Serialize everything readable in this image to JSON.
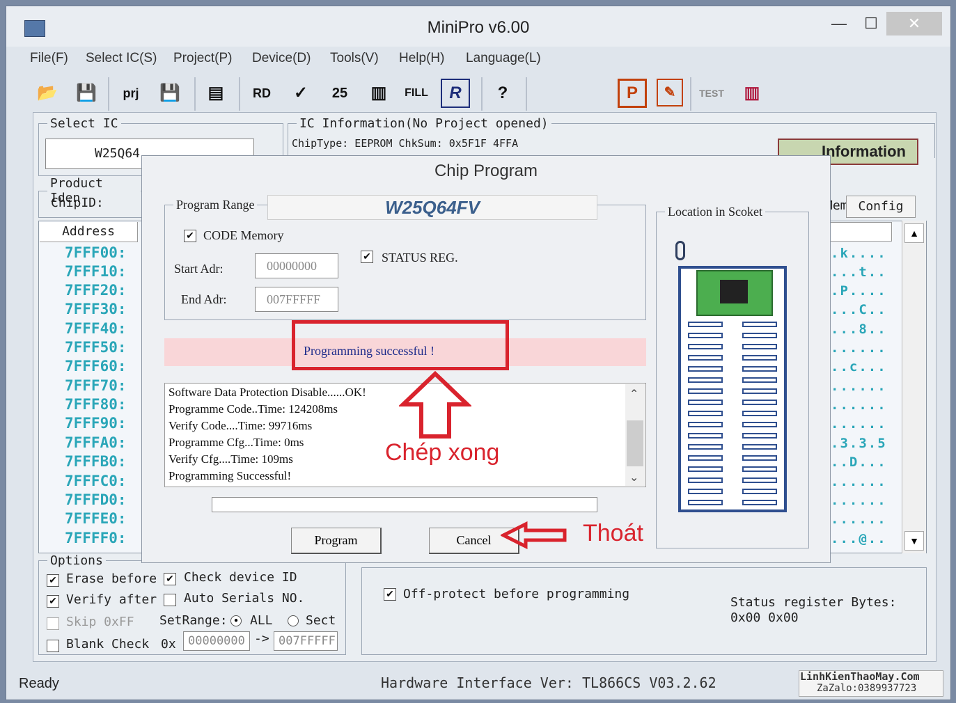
{
  "window": {
    "title": "MiniPro v6.00",
    "min": "—",
    "max": "☐",
    "close": "✕"
  },
  "menu": [
    "File(F)",
    "Select IC(S)",
    "Project(P)",
    "Device(D)",
    "Tools(V)",
    "Help(H)",
    "Language(L)"
  ],
  "toolbar": {
    "icons": [
      "open-icon",
      "save-icon",
      "save-project-icon",
      "load-project-icon",
      "chip-icon",
      "read-icon",
      "verify-icon",
      "blank-check-icon",
      "program-icon",
      "fill-icon",
      "read-r-icon",
      "help-icon"
    ],
    "glyphs": [
      "📂",
      "💾",
      "prj",
      "💾",
      "▤",
      "RD",
      "✓",
      "25",
      "▥",
      "FILL",
      "R",
      "?"
    ],
    "right_glyphs": [
      "P",
      "✎",
      "TEST",
      "▥"
    ]
  },
  "select_ic": {
    "legend": "Select IC",
    "value": "W25Q64"
  },
  "ic_info": {
    "legend": "IC Information(No Project opened)",
    "line": "ChipType: EEPROM      ChkSum: 0x5F1F 4FFA"
  },
  "information_button": "Information",
  "product_id": {
    "legend": "Product Iden",
    "label": "ChipID:"
  },
  "right_tabs": {
    "memo": "Memo",
    "config": "Config"
  },
  "hex": {
    "header": "Address",
    "addresses": [
      "7FFF00:",
      "7FFF10:",
      "7FFF20:",
      "7FFF30:",
      "7FFF40:",
      "7FFF50:",
      "7FFF60:",
      "7FFF70:",
      "7FFF80:",
      "7FFF90:",
      "7FFFA0:",
      "7FFFB0:",
      "7FFFC0:",
      "7FFFD0:",
      "7FFFE0:",
      "7FFFF0:"
    ],
    "ascii": [
      ".k....",
      "...t..",
      ".P....",
      "...C..",
      "...8..",
      "......",
      "..c...",
      "......",
      "......",
      "......",
      ".3.3.5",
      "..D...",
      "......",
      "......",
      "......",
      "...@.."
    ]
  },
  "options": {
    "legend": "Options",
    "erase_before": "Erase before",
    "check_device_id": "Check device ID",
    "verify_after": "Verify after",
    "auto_serials": "Auto Serials NO.",
    "skip_0xff": "Skip 0xFF",
    "setrange": "SetRange:",
    "all": "ALL",
    "sect": "Sect",
    "blank_check": "Blank Check",
    "ox": "0x",
    "range_start": "00000000",
    "arrow": "->",
    "range_end": "007FFFFF",
    "off_protect": "Off-protect before programming",
    "status_register_label": "Status register Bytes:",
    "status_register_value": "0x00 0x00"
  },
  "statusbar": {
    "ready": "Ready",
    "hardware": "Hardware Interface Ver: TL866CS V03.2.62",
    "watermark_line1": "LinhKienThaoMay.Com",
    "watermark_line2": "ZaZalo:0389937723"
  },
  "dialog": {
    "title": "Chip Program",
    "chip_name": "W25Q64FV",
    "program_range_legend": "Program Range",
    "code_memory": "CODE Memory",
    "status_reg": "STATUS REG.",
    "start_label": "Start Adr:",
    "start_value": "00000000",
    "end_label": "End Adr:",
    "end_value": "007FFFFF",
    "result": "Programming successful !",
    "log": [
      "Software Data Protection Disable......OK!",
      "Programme Code..Time: 124208ms",
      "Verify Code....Time: 99716ms",
      "Programme Cfg...Time: 0ms",
      "Verify Cfg....Time: 109ms",
      "Programming Successful!"
    ],
    "location_legend": "Location in Scoket",
    "program_button": "Program",
    "cancel_button": "Cancel"
  },
  "annotations": {
    "done": "Chép xong",
    "exit": "Thoát",
    "accent": "#d9232d"
  }
}
